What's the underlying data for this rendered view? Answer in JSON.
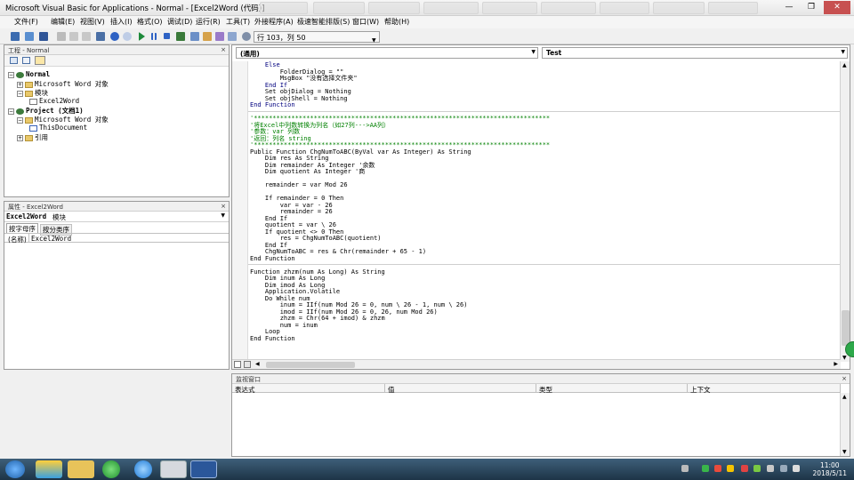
{
  "window": {
    "title": "Microsoft Visual Basic for Applications - Normal - [Excel2Word (代码)]",
    "minimize": "—",
    "maximize": "❐",
    "close": "✕"
  },
  "menubar": [
    "文件(F)",
    "编辑(E)",
    "视图(V)",
    "插入(I)",
    "格式(O)",
    "调试(D)",
    "运行(R)",
    "工具(T)",
    "外接程序(A)",
    "极速智能排版(S)",
    "窗口(W)",
    "帮助(H)"
  ],
  "toolbar": {
    "position": "行 103，列 50"
  },
  "project_pane": {
    "title": "工程 - Normal",
    "close": "×",
    "tree": [
      {
        "label": "Normal",
        "bold": true
      },
      {
        "label": "Microsoft Word 对象"
      },
      {
        "label": "模块"
      },
      {
        "label": "Excel2Word"
      },
      {
        "label": "Project (文档1)",
        "bold": true
      },
      {
        "label": "Microsoft Word 对象"
      },
      {
        "label": "ThisDocument"
      },
      {
        "label": "引用"
      }
    ]
  },
  "properties_pane": {
    "title": "属性 - Excel2Word",
    "close": "×",
    "object_name": "Excel2Word",
    "object_type": "模块",
    "tabs": [
      "按字母序",
      "按分类序"
    ],
    "row_name": "(名称)",
    "row_value": "Excel2Word"
  },
  "code_window": {
    "object_combo": "(通用)",
    "proc_combo": "Test",
    "lines": [
      {
        "t": "    Else",
        "c": "kw"
      },
      {
        "t": "        FolderDialog = \"\"",
        "c": ""
      },
      {
        "t": "        MsgBox \"没有选择文件夹\"",
        "c": ""
      },
      {
        "t": "    End If",
        "c": "kw"
      },
      {
        "t": "    Set objDialog = Nothing",
        "c": ""
      },
      {
        "t": "    Set objShell = Nothing",
        "c": ""
      },
      {
        "t": "End Function",
        "c": "kw"
      },
      {
        "t": "",
        "c": "sep"
      },
      {
        "t": "'*******************************************************************************",
        "c": "cm"
      },
      {
        "t": "'将Excel中列数转换为列名（如27列--->AA列）",
        "c": "cm"
      },
      {
        "t": "'参数：var 列数",
        "c": "cm"
      },
      {
        "t": "'返回：列名 string",
        "c": "cm"
      },
      {
        "t": "'*******************************************************************************",
        "c": "cm"
      },
      {
        "t": "Public Function ChgNumToABC(ByVal var As Integer) As String",
        "c": ""
      },
      {
        "t": "    Dim res As String",
        "c": ""
      },
      {
        "t": "    Dim remainder As Integer '余数",
        "c": ""
      },
      {
        "t": "    Dim quotient As Integer '商",
        "c": ""
      },
      {
        "t": "",
        "c": ""
      },
      {
        "t": "    remainder = var Mod 26",
        "c": ""
      },
      {
        "t": "",
        "c": ""
      },
      {
        "t": "    If remainder = 0 Then",
        "c": ""
      },
      {
        "t": "        var = var - 26",
        "c": ""
      },
      {
        "t": "        remainder = 26",
        "c": ""
      },
      {
        "t": "    End If",
        "c": ""
      },
      {
        "t": "    quotient = var \\ 26",
        "c": ""
      },
      {
        "t": "    If quotient <> 0 Then",
        "c": ""
      },
      {
        "t": "        res = ChgNumToABC(quotient)",
        "c": ""
      },
      {
        "t": "    End If",
        "c": ""
      },
      {
        "t": "    ChgNumToABC = res & Chr(remainder + 65 - 1)",
        "c": ""
      },
      {
        "t": "End Function",
        "c": ""
      },
      {
        "t": "",
        "c": "sep"
      },
      {
        "t": "Function zhzm(num As Long) As String",
        "c": ""
      },
      {
        "t": "    Dim inum As Long",
        "c": ""
      },
      {
        "t": "    Dim imod As Long",
        "c": ""
      },
      {
        "t": "    Application.Volatile",
        "c": ""
      },
      {
        "t": "    Do While num",
        "c": ""
      },
      {
        "t": "        inum = IIf(num Mod 26 = 0, num \\ 26 - 1, num \\ 26)",
        "c": ""
      },
      {
        "t": "        imod = IIf(num Mod 26 = 0, 26, num Mod 26)",
        "c": ""
      },
      {
        "t": "        zhzm = Chr(64 + imod) & zhzm",
        "c": ""
      },
      {
        "t": "        num = inum",
        "c": ""
      },
      {
        "t": "    Loop",
        "c": ""
      },
      {
        "t": "End Function",
        "c": ""
      }
    ]
  },
  "watch_pane": {
    "title": "监视窗口",
    "close": "×",
    "columns": [
      "表达式",
      "值",
      "类型",
      "上下文"
    ]
  },
  "taskbar": {
    "time": "11:00",
    "date": "2018/5/11"
  }
}
